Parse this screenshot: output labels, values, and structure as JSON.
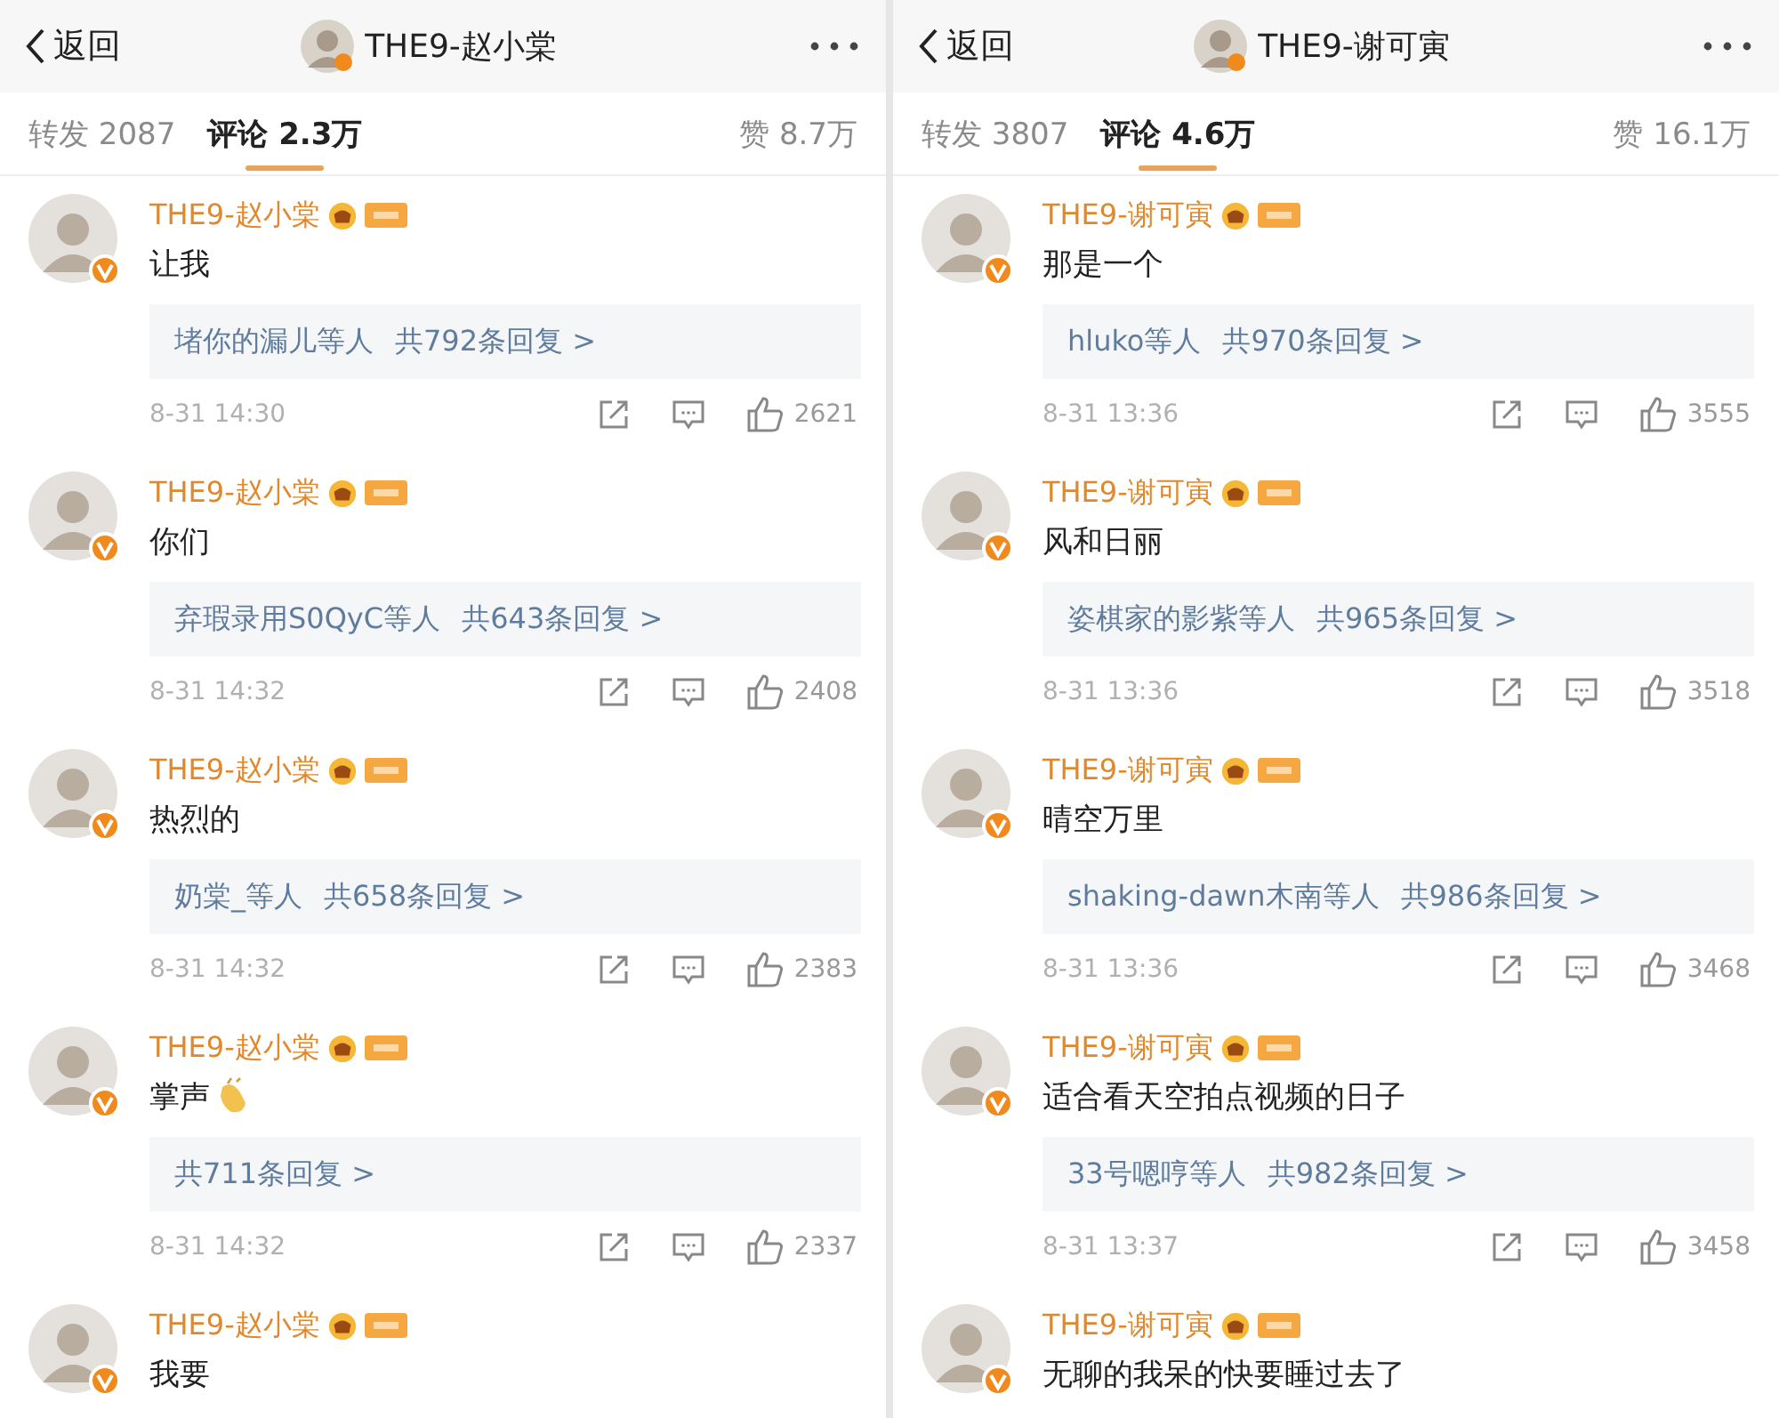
{
  "panels": [
    {
      "header": {
        "back": "返回",
        "title": "THE9-赵小棠"
      },
      "tabs": [
        {
          "label": "转发 2087",
          "selected": false
        },
        {
          "label": "评论 2.3万",
          "selected": true
        }
      ],
      "likes": "赞 8.7万",
      "comments": [
        {
          "author": "THE9-赵小棠",
          "text": "让我",
          "emoji": false,
          "reply": {
            "users": "堵你的漏儿等人",
            "total": "共792条回复 >"
          },
          "time": "8-31 14:30",
          "likes": "2621"
        },
        {
          "author": "THE9-赵小棠",
          "text": "你们",
          "emoji": false,
          "reply": {
            "users": "弃瑕录用S0QyC等人",
            "total": "共643条回复 >"
          },
          "time": "8-31 14:32",
          "likes": "2408"
        },
        {
          "author": "THE9-赵小棠",
          "text": "热烈的",
          "emoji": false,
          "reply": {
            "users": "奶棠_等人",
            "total": "共658条回复 >"
          },
          "time": "8-31 14:32",
          "likes": "2383"
        },
        {
          "author": "THE9-赵小棠",
          "text": "掌声",
          "emoji": true,
          "reply": {
            "total": "共711条回复 >"
          },
          "time": "8-31 14:32",
          "likes": "2337"
        },
        {
          "author": "THE9-赵小棠",
          "text": "我要",
          "emoji": false
        }
      ]
    },
    {
      "header": {
        "back": "返回",
        "title": "THE9-谢可寅"
      },
      "tabs": [
        {
          "label": "转发 3807",
          "selected": false
        },
        {
          "label": "评论 4.6万",
          "selected": true
        }
      ],
      "likes": "赞 16.1万",
      "comments": [
        {
          "author": "THE9-谢可寅",
          "text": "那是一个",
          "emoji": false,
          "reply": {
            "users": "hluko等人",
            "total": "共970条回复 >"
          },
          "time": "8-31 13:36",
          "likes": "3555"
        },
        {
          "author": "THE9-谢可寅",
          "text": "风和日丽",
          "emoji": false,
          "reply": {
            "users": "姿棋家的影紫等人",
            "total": "共965条回复 >"
          },
          "time": "8-31 13:36",
          "likes": "3518"
        },
        {
          "author": "THE9-谢可寅",
          "text": "晴空万里",
          "emoji": false,
          "reply": {
            "users": "shaking-dawn木南等人",
            "total": "共986条回复 >"
          },
          "time": "8-31 13:36",
          "likes": "3468"
        },
        {
          "author": "THE9-谢可寅",
          "text": "适合看天空拍点视频的日子",
          "emoji": false,
          "reply": {
            "users": "33号嗯哼等人",
            "total": "共982条回复 >"
          },
          "time": "8-31 13:37",
          "likes": "3458"
        },
        {
          "author": "THE9-谢可寅",
          "text": "无聊的我呆的快要睡过去了",
          "emoji": false
        }
      ]
    }
  ]
}
